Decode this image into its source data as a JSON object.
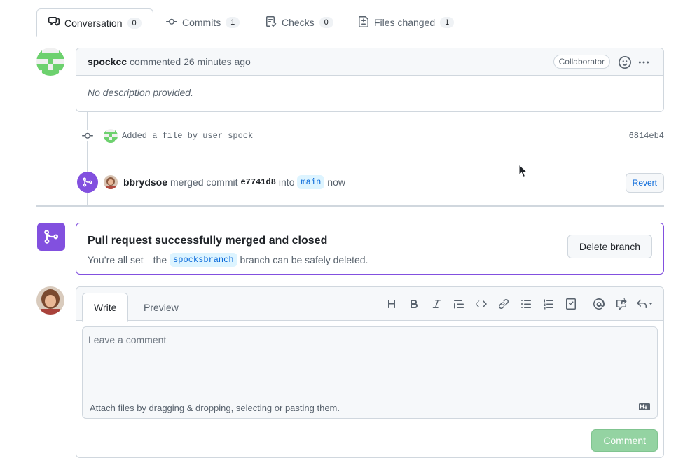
{
  "tabs": [
    {
      "label": "Conversation",
      "count": "0"
    },
    {
      "label": "Commits",
      "count": "1"
    },
    {
      "label": "Checks",
      "count": "0"
    },
    {
      "label": "Files changed",
      "count": "1"
    }
  ],
  "comment": {
    "author": "spockcc",
    "action": "commented 26 minutes ago",
    "role": "Collaborator",
    "body": "No description provided."
  },
  "commit": {
    "message": "Added a file by user spock",
    "sha": "6814eb4"
  },
  "merge_event": {
    "user": "bbrydsoe",
    "text_merged": "merged commit",
    "commit": "e7741d8",
    "text_into": "into",
    "branch": "main",
    "time": "now",
    "revert_label": "Revert"
  },
  "merged_box": {
    "title": "Pull request successfully merged and closed",
    "sub_prefix": "You’re all set—the",
    "branch": "spocksbranch",
    "sub_suffix": "branch can be safely deleted.",
    "delete_label": "Delete branch"
  },
  "editor": {
    "tab_write": "Write",
    "tab_preview": "Preview",
    "placeholder": "Leave a comment",
    "attach_text": "Attach files by dragging & dropping, selecting or pasting them.",
    "submit_label": "Comment"
  },
  "colors": {
    "accent_purple": "#8250df",
    "link_blue": "#0969da",
    "comment_btn_disabled": "#94d3a2"
  }
}
